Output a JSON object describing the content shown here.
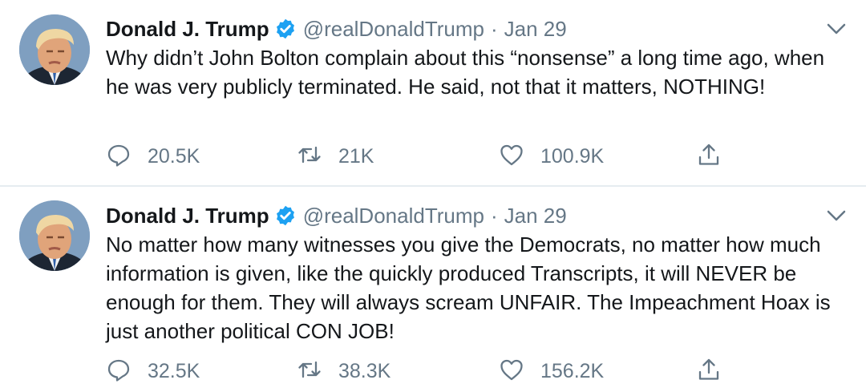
{
  "tweets": [
    {
      "author_name": "Donald J. Trump",
      "handle": "@realDonaldTrump",
      "separator": "·",
      "date": "Jan 29",
      "text": "Why didn’t John Bolton complain about this “nonsense” a long time ago, when he was very publicly terminated. He said, not that it matters, NOTHING!",
      "replies": "20.5K",
      "retweets": "21K",
      "likes": "100.9K"
    },
    {
      "author_name": "Donald J. Trump",
      "handle": "@realDonaldTrump",
      "separator": "·",
      "date": "Jan 29",
      "text": "No matter how many witnesses you give the Democrats, no matter how much information is given, like the quickly produced Transcripts, it will NEVER be enough for them. They will always scream UNFAIR. The Impeachment Hoax is just another political CON JOB!",
      "replies": "32.5K",
      "retweets": "38.3K",
      "likes": "156.2K"
    }
  ],
  "colors": {
    "text": "#14171a",
    "secondary": "#657786",
    "verified": "#1da1f2",
    "divider": "#e6ecf0"
  },
  "icons": [
    "verified-badge-icon",
    "chevron-down-icon",
    "reply-icon",
    "retweet-icon",
    "like-icon",
    "share-icon"
  ]
}
